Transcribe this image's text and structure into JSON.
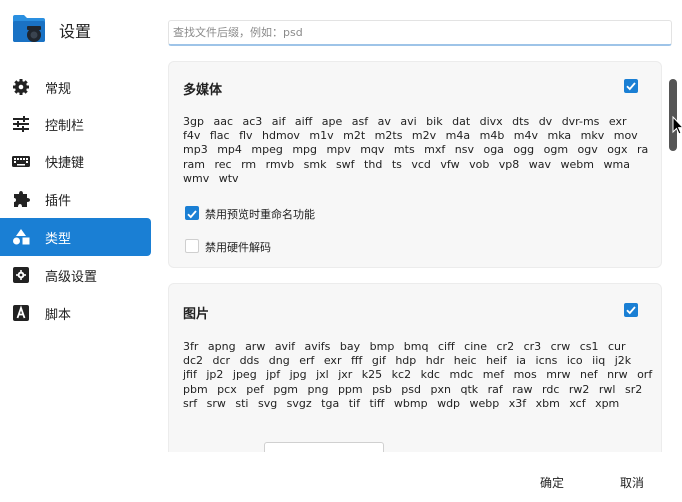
{
  "app": {
    "title": "设置",
    "icon": "folder-camera-icon"
  },
  "sidebar": {
    "items": [
      {
        "label": "常规",
        "icon": "gear-icon",
        "active": false
      },
      {
        "label": "控制栏",
        "icon": "sliders-icon",
        "active": false
      },
      {
        "label": "快捷键",
        "icon": "keyboard-icon",
        "active": false
      },
      {
        "label": "插件",
        "icon": "puzzle-icon",
        "active": false
      },
      {
        "label": "类型",
        "icon": "shapes-icon",
        "active": true
      },
      {
        "label": "高级设置",
        "icon": "advanced-settings-icon",
        "active": false
      },
      {
        "label": "脚本",
        "icon": "script-icon",
        "active": false
      }
    ]
  },
  "search": {
    "placeholder": "查找文件后缀，例如：psd",
    "value": ""
  },
  "sections": [
    {
      "title": "多媒体",
      "enabled": true,
      "extensions": "3gp aac ac3 aif aiff ape asf av avi bik dat divx dts dv dvr-ms exr f4v flac flv hdmov m1v m2t m2ts m2v m4a m4b m4v mka mkv mov mp3 mp4 mpeg mpg mpv mqv mts mxf nsv oga ogg ogm ogv ogx ra ram rec rm rmvb smk swf thd ts vcd vfw vob vp8 wav webm wma wmv wtv",
      "options": [
        {
          "label": "禁用预览时重命名功能",
          "checked": true
        },
        {
          "label": "禁用硬件解码",
          "checked": false
        }
      ]
    },
    {
      "title": "图片",
      "enabled": true,
      "extensions": "3fr apng arw avif avifs bay bmp bmq ciff cine cr2 cr3 crw cs1 cur dc2 dcr dds dng erf exr fff gif hdp hdr heic heif ia icns ico iiq j2k jfif jp2 jpeg jpf jpg jxl jxr k25 kc2 kdc mdc mef mos mrw nef nrw orf pbm pcx pef pgm png ppm psb psd pxn qtk raf raw rdc rw2 rwl sr2 srf srw sti svg svgz tga tif tiff wbmp wdp webp x3f xbm xcf xpm"
    }
  ],
  "footer": {
    "confirm_label": "确定",
    "cancel_label": "取消"
  },
  "colors": {
    "accent": "#1a7fd4",
    "card_bg": "#f7f7f7"
  }
}
